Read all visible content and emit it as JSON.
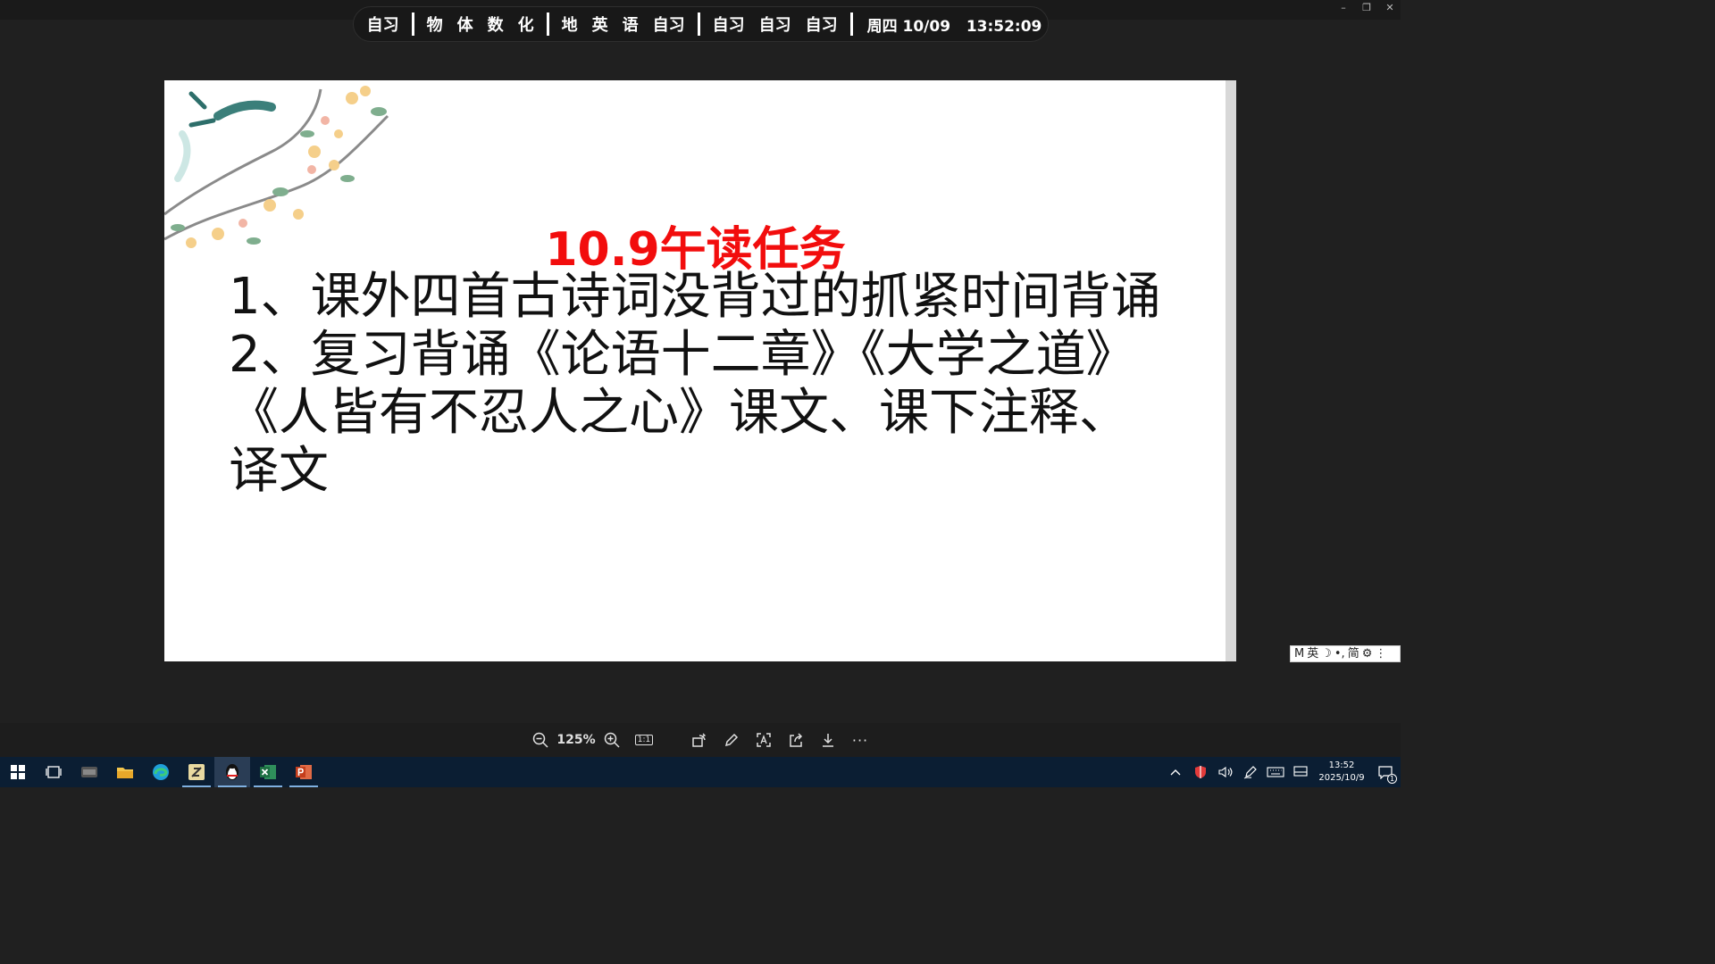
{
  "window": {
    "minimize": "–",
    "restore": "❐",
    "close": "✕"
  },
  "schedule": {
    "groups": [
      [
        "自习"
      ],
      [
        "物",
        "体",
        "数",
        "化"
      ],
      [
        "地",
        "英",
        "语",
        "自习"
      ],
      [
        "自习",
        "自习",
        "自习"
      ]
    ],
    "day": "周四",
    "date": "10/09",
    "time": "13:52:09"
  },
  "slide": {
    "title": "10.9午读任务",
    "lines": [
      "1、课外四首古诗词没背过的抓紧时间背诵",
      "2、复习背诵《论语十二章》《大学之道》《人皆有不忍人之心》课文、课下注释、译文"
    ]
  },
  "ime": {
    "mode_m": "M",
    "lang": "英",
    "moon": "☽",
    "punct": "•,",
    "script": "简",
    "settings": "⚙",
    "more": "⋮"
  },
  "toolbar": {
    "zoom": "125%",
    "actual_size": "1:1",
    "more": "···"
  },
  "taskbar": {
    "apps": [
      "start-icon",
      "task-view-icon",
      "unknown-app-icon",
      "file-explorer-icon",
      "edge-icon",
      "note-app-icon",
      "qq-icon",
      "excel-icon",
      "powerpoint-icon"
    ],
    "clock_time": "13:52",
    "clock_date": "2025/10/9",
    "notification_count": "1",
    "colors": {
      "taskbar": "#0b1e33",
      "excel": "#1d6f42",
      "powerpoint": "#c43e1c",
      "title_red": "#f20d0d"
    }
  }
}
